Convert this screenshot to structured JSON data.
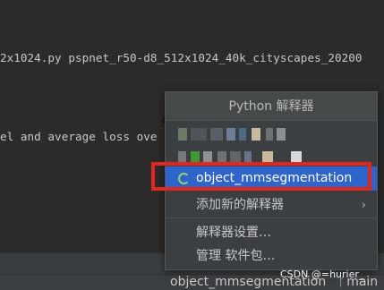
{
  "terminal": {
    "line1": "2x1024.py pspnet_r50-d8_512x1024_40k_cityscapes_20200",
    "line2": "el and average loss ove"
  },
  "popup": {
    "title": "Python 解释器",
    "items": {
      "current": "object_mmsegmentation",
      "add": "添加新的解释器",
      "settings": "解释器设置…",
      "manage": "管理 软件包…"
    }
  },
  "statusbar": {
    "interpreter": "object_mmsegmentation",
    "branch": "main"
  },
  "watermark": "CSDN @=hurier_",
  "colors": {
    "selected": "#2f65ca",
    "highlight_box": "#e3271e",
    "spinner": "#8fd16d"
  }
}
